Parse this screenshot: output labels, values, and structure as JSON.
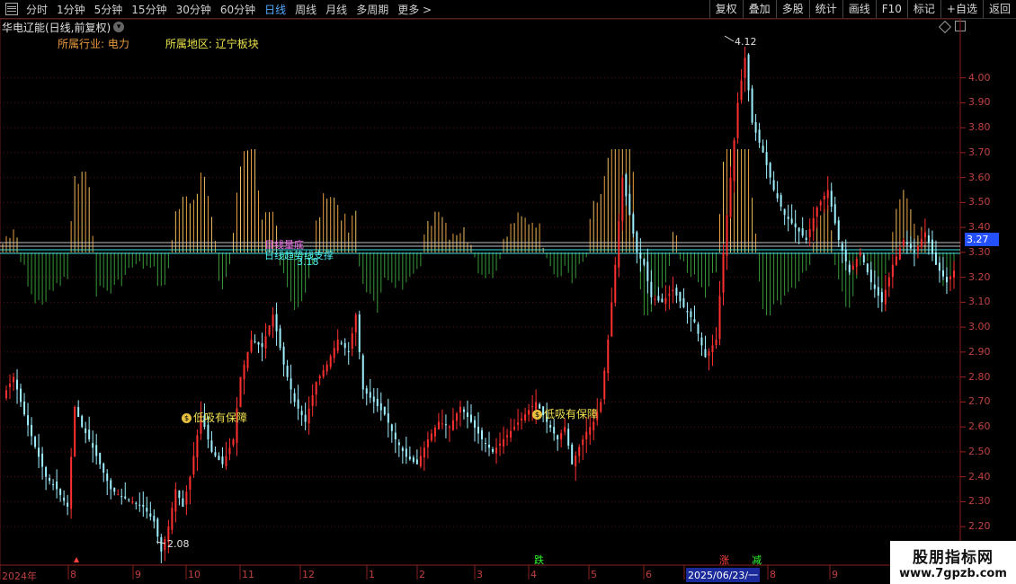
{
  "toolbar": {
    "tabs": [
      "分时",
      "1分钟",
      "5分钟",
      "15分钟",
      "30分钟",
      "60分钟",
      "日线",
      "周线",
      "月线",
      "多周期",
      "更多 >"
    ],
    "active_tab": "日线",
    "right_buttons": [
      "复权",
      "叠加",
      "多股",
      "统计",
      "画线",
      "F10",
      "标记",
      "+自选",
      "返回"
    ]
  },
  "title": "华电辽能(日线,前复权)",
  "info": {
    "industry": "所属行业:  电力",
    "region": "所属地区:  辽宁板块"
  },
  "price_tag": "3.27",
  "markers": {
    "high": "4.12",
    "low": "2.08"
  },
  "annotations": {
    "low_buy_1": "低吸有保障",
    "low_buy_2": "低吸有保障"
  },
  "overlay_labels": {
    "l1": "日线量底",
    "l2": "日线趋势线支撑",
    "l3": "3.18"
  },
  "events": {
    "e1": "跌",
    "e2": "涨",
    "e3": "减"
  },
  "dates": [
    "2024年",
    "8",
    "9",
    "10",
    "11",
    "12",
    "1",
    "2",
    "3",
    "4",
    "5",
    "6",
    "2025/06/23/一",
    "8",
    "9"
  ],
  "watermark": {
    "line1": "股朋指标网",
    "line2": "www.7gpzb.com"
  },
  "colors": {
    "up": "#ff3030",
    "down": "#9ff0ff",
    "volume_up": "#e8a040",
    "volume_down": "#3a9a3a",
    "axis": "#c04040"
  },
  "chart_data": {
    "type": "candlestick",
    "y_ticks": [
      "4.00",
      "3.90",
      "3.80",
      "3.70",
      "3.60",
      "3.50",
      "3.40",
      "3.30",
      "3.20",
      "3.10",
      "3.00",
      "2.90",
      "2.80",
      "2.70",
      "2.60",
      "2.50",
      "2.40",
      "2.30",
      "2.20"
    ],
    "ylim": [
      2.15,
      4.15
    ],
    "close_path": [
      [
        0,
        2.72
      ],
      [
        3,
        2.8
      ],
      [
        6,
        2.65
      ],
      [
        9,
        2.52
      ],
      [
        12,
        2.4
      ],
      [
        15,
        2.35
      ],
      [
        18,
        2.28
      ],
      [
        20,
        2.68
      ],
      [
        22,
        2.6
      ],
      [
        24,
        2.55
      ],
      [
        27,
        2.45
      ],
      [
        30,
        2.35
      ],
      [
        33,
        2.32
      ],
      [
        36,
        2.3
      ],
      [
        39,
        2.28
      ],
      [
        42,
        2.22
      ],
      [
        44,
        2.1
      ],
      [
        46,
        2.2
      ],
      [
        48,
        2.35
      ],
      [
        50,
        2.28
      ],
      [
        52,
        2.4
      ],
      [
        55,
        2.65
      ],
      [
        58,
        2.5
      ],
      [
        61,
        2.45
      ],
      [
        64,
        2.55
      ],
      [
        66,
        2.8
      ],
      [
        69,
        2.95
      ],
      [
        72,
        2.92
      ],
      [
        75,
        3.05
      ],
      [
        78,
        2.85
      ],
      [
        81,
        2.7
      ],
      [
        84,
        2.62
      ],
      [
        87,
        2.78
      ],
      [
        90,
        2.85
      ],
      [
        93,
        2.95
      ],
      [
        96,
        2.9
      ],
      [
        98,
        3.05
      ],
      [
        100,
        2.75
      ],
      [
        103,
        2.7
      ],
      [
        106,
        2.65
      ],
      [
        109,
        2.55
      ],
      [
        112,
        2.48
      ],
      [
        115,
        2.45
      ],
      [
        118,
        2.55
      ],
      [
        121,
        2.62
      ],
      [
        124,
        2.6
      ],
      [
        127,
        2.68
      ],
      [
        130,
        2.62
      ],
      [
        133,
        2.55
      ],
      [
        136,
        2.5
      ],
      [
        139,
        2.55
      ],
      [
        142,
        2.6
      ],
      [
        145,
        2.65
      ],
      [
        148,
        2.7
      ],
      [
        151,
        2.62
      ],
      [
        154,
        2.55
      ],
      [
        156,
        2.6
      ],
      [
        158,
        2.45
      ],
      [
        160,
        2.52
      ],
      [
        162,
        2.58
      ],
      [
        164,
        2.62
      ],
      [
        166,
        2.7
      ],
      [
        168,
        2.95
      ],
      [
        170,
        3.25
      ],
      [
        172,
        3.6
      ],
      [
        174,
        3.45
      ],
      [
        176,
        3.3
      ],
      [
        178,
        3.25
      ],
      [
        180,
        3.12
      ],
      [
        183,
        3.1
      ],
      [
        186,
        3.15
      ],
      [
        189,
        3.08
      ],
      [
        192,
        3.02
      ],
      [
        195,
        2.88
      ],
      [
        198,
        2.95
      ],
      [
        200,
        3.3
      ],
      [
        202,
        3.6
      ],
      [
        204,
        3.9
      ],
      [
        206,
        4.08
      ],
      [
        208,
        3.82
      ],
      [
        211,
        3.7
      ],
      [
        214,
        3.55
      ],
      [
        217,
        3.45
      ],
      [
        220,
        3.4
      ],
      [
        223,
        3.35
      ],
      [
        226,
        3.48
      ],
      [
        229,
        3.55
      ],
      [
        232,
        3.35
      ],
      [
        235,
        3.22
      ],
      [
        238,
        3.3
      ],
      [
        241,
        3.18
      ],
      [
        244,
        3.1
      ],
      [
        247,
        3.25
      ],
      [
        250,
        3.35
      ],
      [
        253,
        3.3
      ],
      [
        256,
        3.38
      ],
      [
        259,
        3.25
      ],
      [
        262,
        3.18
      ],
      [
        265,
        3.25
      ]
    ],
    "volume_period_count": 265
  }
}
